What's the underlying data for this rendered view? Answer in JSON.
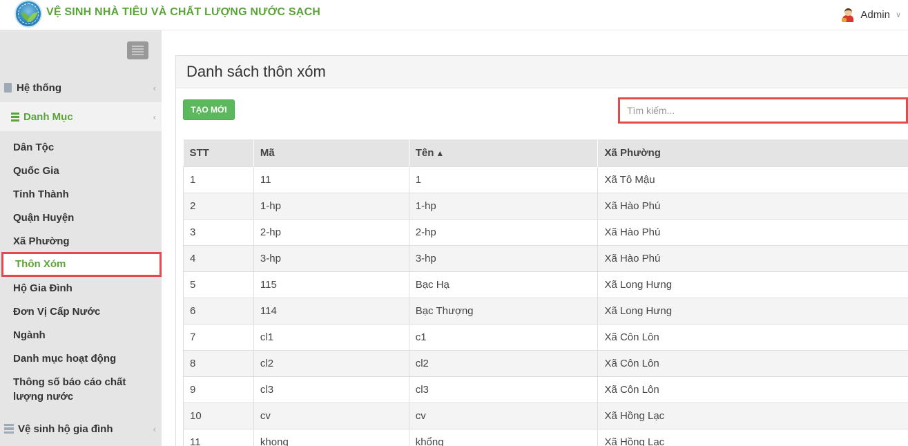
{
  "header": {
    "app_title": "VỆ SINH NHÀ TIÊU VÀ CHẤT LƯỢNG NƯỚC SẠCH",
    "user_name": "Admin",
    "chevron": "∨"
  },
  "sidebar": {
    "sections": {
      "system": "Hệ thống",
      "danhmuc": "Danh Mục",
      "vesinh": "Vệ sinh hộ gia đình"
    },
    "items": [
      "Dân Tộc",
      "Quốc Gia",
      "Tỉnh Thành",
      "Quận Huyện",
      "Xã Phường",
      "Thôn Xóm",
      "Hộ Gia Đình",
      "Đơn Vị Cấp Nước",
      "Ngành",
      "Danh mục hoạt động",
      "Thông số báo cáo chất lượng nước"
    ],
    "active_item": "Thôn Xóm"
  },
  "main": {
    "title": "Danh sách thôn xóm",
    "new_button": "TẠO MỚI",
    "search_placeholder": "Tìm kiếm...",
    "columns": [
      "STT",
      "Mã",
      "Tên",
      "Xã Phường"
    ],
    "sort_icon": "▲",
    "rows": [
      [
        "1",
        "11",
        "1",
        "Xã Tô Mậu"
      ],
      [
        "2",
        "1-hp",
        "1-hp",
        "Xã Hào Phú"
      ],
      [
        "3",
        "2-hp",
        "2-hp",
        "Xã Hào Phú"
      ],
      [
        "4",
        "3-hp",
        "3-hp",
        "Xã Hào Phú"
      ],
      [
        "5",
        "115",
        "Bạc Hạ",
        "Xã Long Hưng"
      ],
      [
        "6",
        "114",
        "Bạc Thượng",
        "Xã Long Hưng"
      ],
      [
        "7",
        "cl1",
        "c1",
        "Xã Côn Lôn"
      ],
      [
        "8",
        "cl2",
        "cl2",
        "Xã Côn Lôn"
      ],
      [
        "9",
        "cl3",
        "cl3",
        "Xã Côn Lôn"
      ],
      [
        "10",
        "cv",
        "cv",
        "Xã Hồng Lạc"
      ],
      [
        "11",
        "khong",
        "khổng",
        "Xã Hồng Lạc"
      ]
    ]
  },
  "colors": {
    "brand_green": "#5aa43a",
    "button_green": "#5cb85c",
    "highlight_red": "#e04b4b",
    "sidebar_bg": "#e5e5e5"
  }
}
